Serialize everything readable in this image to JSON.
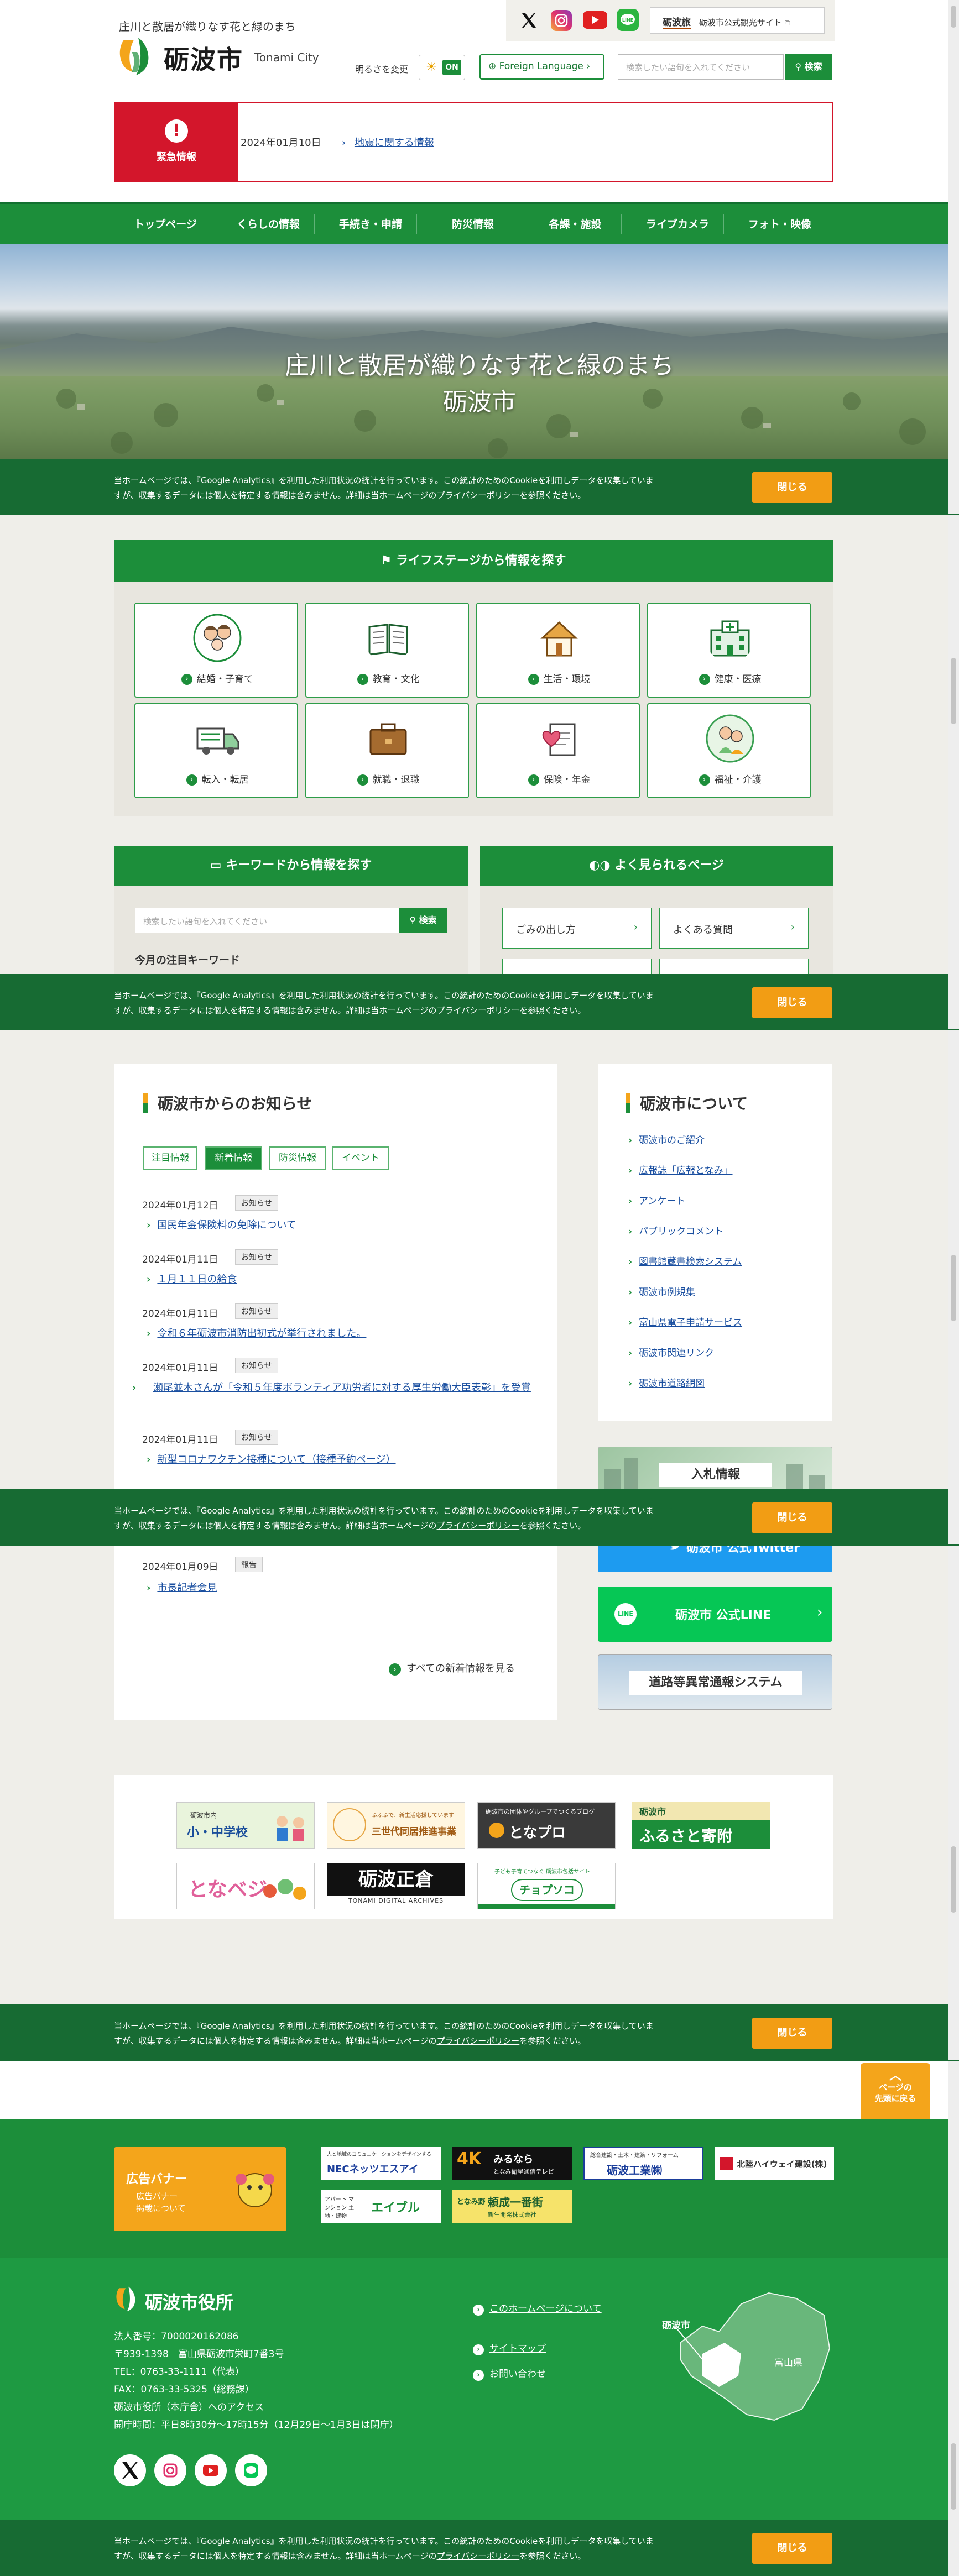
{
  "header": {
    "tagline": "庄川と散居が織りなす花と緑のまち",
    "logo_text": "砺波市",
    "logo_sub": "Tonami City",
    "kanko_badge": "砺波旅",
    "kanko_label": "砺波市公式観光サイト",
    "brightness_label": "明るさを変更",
    "brightness_state": "ON",
    "lang_label": "Foreign Language",
    "search_placeholder": "検索したい語句を入れてください",
    "search_button": "検索"
  },
  "emergency": {
    "label": "緊急情報",
    "date": "2024年01月10日",
    "link": "地震に関する情報"
  },
  "nav": [
    "トップページ",
    "くらしの情報",
    "手続き・申請",
    "防災情報",
    "各課・施設",
    "ライブカメラ",
    "フォト・映像"
  ],
  "hero": {
    "line1": "庄川と散居が織りなす花と緑のまち",
    "line2": "砺波市"
  },
  "cookie": {
    "text1": "当ホームページでは、『Google Analytics』を利用した利用状況の統計を行っています。この統計のためのCookieを利用しデータを収集していま",
    "text2": "すが、収集するデータには個人を特定する情報は含みません。詳細は当ホームページの",
    "link": "プライバシーポリシー",
    "text3": "を参照ください。",
    "close": "閉じる"
  },
  "life_stage": {
    "title": "ライフステージから情報を探す",
    "items": [
      "結婚・子育て",
      "教育・文化",
      "生活・環境",
      "健康・医療",
      "転入・転居",
      "就職・退職",
      "保険・年金",
      "福祉・介護"
    ]
  },
  "keyword": {
    "title": "キーワードから情報を探す",
    "placeholder": "検索したい語句を入れてください",
    "button": "検索",
    "subtitle": "今月の注目キーワード"
  },
  "popular": {
    "title": "よく見られるページ",
    "items": [
      "ごみの出し方",
      "よくある質問"
    ]
  },
  "news": {
    "title": "砺波市からのお知らせ",
    "tabs": [
      "注目情報",
      "新着情報",
      "防災情報",
      "イベント"
    ],
    "items": [
      {
        "date": "2024年01月12日",
        "cat": "お知らせ",
        "title": "国民年金保険料の免除について"
      },
      {
        "date": "2024年01月11日",
        "cat": "お知らせ",
        "title": "１月１１日の給食"
      },
      {
        "date": "2024年01月11日",
        "cat": "お知らせ",
        "title": "令和６年砺波市消防出初式が挙行されました。"
      },
      {
        "date": "2024年01月11日",
        "cat": "お知らせ",
        "title": "瀬尾並木さんが「令和５年度ボランティア功労者に対する厚生労働大臣表彰」を受賞"
      },
      {
        "date": "2024年01月11日",
        "cat": "お知らせ",
        "title": "新型コロナワクチン接種について（接種予約ページ）"
      },
      {
        "date": "2024年01月09日",
        "cat": "報告",
        "title": "市長記者会見"
      }
    ],
    "more": "すべての新着情報を見る"
  },
  "about": {
    "title": "砺波市について",
    "links": [
      "砺波市のご紹介",
      "広報誌「広報となみ」",
      "アンケート",
      "パブリックコメント",
      "図書館蔵書検索システム",
      "砺波市例規集",
      "富山県電子申請サービス",
      "砺波市関連リンク",
      "砺波市道路網図"
    ]
  },
  "side_banners": {
    "nyusatsu": "入札情報",
    "twitter": "砺波市 公式Twitter",
    "line": "砺波市 公式LINE",
    "road": "道路等異常通報システム"
  },
  "link_banners": {
    "school_small": "砺波市内",
    "school": "小・中学校",
    "sansedai": "三世代同居推進事業",
    "sansedai_small": "ふふふで、新生活応援しています",
    "tonapuro_small": "砺波市の団体やグループでつくるブログ",
    "tonapuro": "となプロ",
    "furusato_small": "砺波市",
    "furusato": "ふるさと寄附",
    "tonaveji": "となベジ",
    "seisouin": "砺波正倉",
    "seisouin_sub": "TONAMI DIGITAL ARCHIVES",
    "chopisoko_small": "子ども子育てつなぐ 砺波市包括サイト",
    "chopisoko": "チョプソコ"
  },
  "ads": {
    "label": "広告バナー",
    "sub1": "広告バナー",
    "sub2": "掲載について",
    "nec_small": "人と地域のコミュニケーションをデザインする",
    "nec": "NECネッツエスアイ",
    "tv_4k": "4K",
    "tv": "みるなら",
    "tv_sub": "となみ衛星通信テレビ",
    "tonami_kogyo_small": "総合建設・土木・建築・リフォーム",
    "tonami_kogyo": "砺波工業㈱",
    "hokuriku": "北陸ハイウェイ建設(株)",
    "eiburu_small": "アパート マンション 土地・建物",
    "eiburu": "エイブル",
    "shinsei_small": "となみ野",
    "shinsei": "頼成一番街",
    "shinsei_sub": "新生開発株式会社"
  },
  "footer": {
    "logo": "砺波市役所",
    "corp_no": "法人番号：7000020162086",
    "address": "〒939-1398　富山県砺波市栄町7番3号",
    "tel": "TEL：0763-33-1111（代表）",
    "fax": "FAX：0763-33-5325（総務課）",
    "access": "砺波市役所（本庁舎）へのアクセス",
    "hours": "開庁時間：平日8時30分〜17時15分（12月29日〜1月3日は閉庁）",
    "links": [
      "このホームページについて",
      "サイトマップ",
      "お問い合わせ"
    ],
    "map_city": "砺波市",
    "map_pref": "富山県"
  },
  "page_top": {
    "line1": "ページの",
    "line2": "先頭に戻る"
  }
}
